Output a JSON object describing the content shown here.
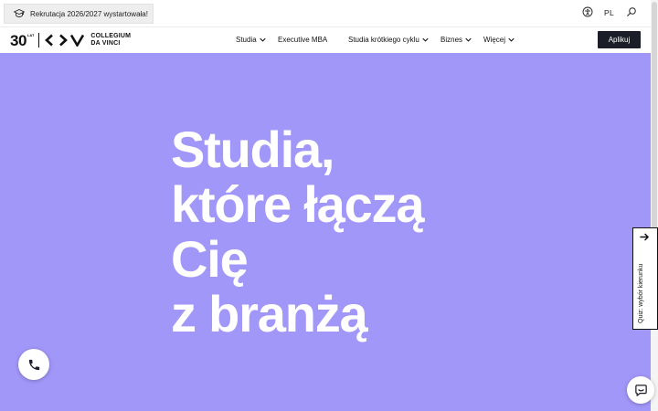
{
  "announcement": {
    "text": "Rekrutacja 2026/2027 wystartowała!",
    "icon": "graduation-cap-icon"
  },
  "utility": {
    "accessibility_icon": "accessibility-icon",
    "language": "PL",
    "search_icon": "search-icon"
  },
  "logo": {
    "years": "30",
    "years_suffix": "LAT",
    "mark": "<>V",
    "line1": "COLLEGIUM",
    "line2": "DA VINCI"
  },
  "nav": {
    "items": [
      {
        "label": "Studia",
        "dropdown": true
      },
      {
        "label": "Executive MBA",
        "dropdown": false
      },
      {
        "label": "Studia krótkiego cyklu",
        "dropdown": true
      },
      {
        "label": "Biznes",
        "dropdown": true
      },
      {
        "label": "Więcej",
        "dropdown": true
      }
    ],
    "cta_label": "Aplikuj"
  },
  "hero": {
    "headline_lines": [
      "Studia,",
      "które łączą",
      "Cię",
      "z branżą"
    ],
    "background_color": "#a197f9"
  },
  "quiz": {
    "label": "Quiz: wybór kierunku",
    "icon": "arrow-right-icon"
  },
  "floating": {
    "phone_icon": "phone-icon",
    "chat_icon": "chat-icon"
  },
  "colors": {
    "hero": "#a197f9",
    "cta": "#1b1d28",
    "text": "#111111"
  }
}
